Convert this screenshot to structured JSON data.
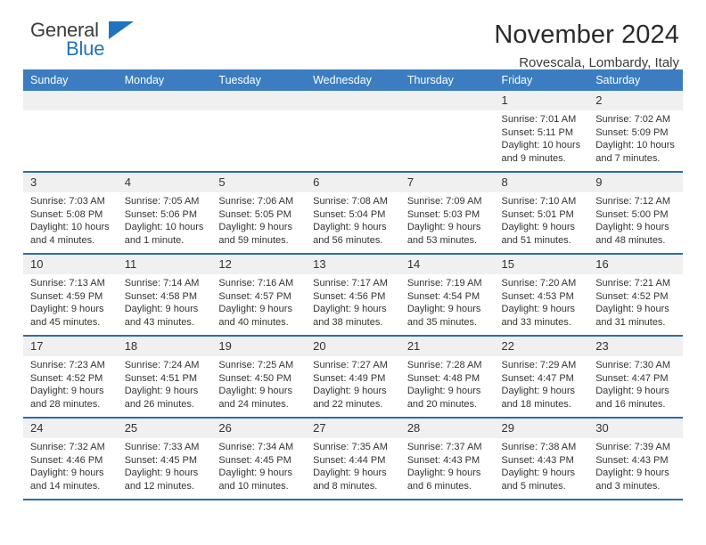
{
  "brand": {
    "name_top": "General",
    "name_bottom": "Blue",
    "triangle_color": "#1f74bd"
  },
  "header": {
    "title": "November 2024",
    "subtitle": "Rovescala, Lombardy, Italy"
  },
  "theme": {
    "header_band": "#3b7dc0",
    "row_rule": "#2a6db4",
    "daynum_band": "#f0f0f0",
    "text": "#333333"
  },
  "weekday_headers": [
    "Sunday",
    "Monday",
    "Tuesday",
    "Wednesday",
    "Thursday",
    "Friday",
    "Saturday"
  ],
  "weeks": [
    [
      {
        "day": "",
        "sunrise": "",
        "sunset": "",
        "daylight": "",
        "empty": true
      },
      {
        "day": "",
        "sunrise": "",
        "sunset": "",
        "daylight": "",
        "empty": true
      },
      {
        "day": "",
        "sunrise": "",
        "sunset": "",
        "daylight": "",
        "empty": true
      },
      {
        "day": "",
        "sunrise": "",
        "sunset": "",
        "daylight": "",
        "empty": true
      },
      {
        "day": "",
        "sunrise": "",
        "sunset": "",
        "daylight": "",
        "empty": true
      },
      {
        "day": "1",
        "sunrise": "Sunrise: 7:01 AM",
        "sunset": "Sunset: 5:11 PM",
        "daylight": "Daylight: 10 hours and 9 minutes.",
        "empty": false
      },
      {
        "day": "2",
        "sunrise": "Sunrise: 7:02 AM",
        "sunset": "Sunset: 5:09 PM",
        "daylight": "Daylight: 10 hours and 7 minutes.",
        "empty": false
      }
    ],
    [
      {
        "day": "3",
        "sunrise": "Sunrise: 7:03 AM",
        "sunset": "Sunset: 5:08 PM",
        "daylight": "Daylight: 10 hours and 4 minutes.",
        "empty": false
      },
      {
        "day": "4",
        "sunrise": "Sunrise: 7:05 AM",
        "sunset": "Sunset: 5:06 PM",
        "daylight": "Daylight: 10 hours and 1 minute.",
        "empty": false
      },
      {
        "day": "5",
        "sunrise": "Sunrise: 7:06 AM",
        "sunset": "Sunset: 5:05 PM",
        "daylight": "Daylight: 9 hours and 59 minutes.",
        "empty": false
      },
      {
        "day": "6",
        "sunrise": "Sunrise: 7:08 AM",
        "sunset": "Sunset: 5:04 PM",
        "daylight": "Daylight: 9 hours and 56 minutes.",
        "empty": false
      },
      {
        "day": "7",
        "sunrise": "Sunrise: 7:09 AM",
        "sunset": "Sunset: 5:03 PM",
        "daylight": "Daylight: 9 hours and 53 minutes.",
        "empty": false
      },
      {
        "day": "8",
        "sunrise": "Sunrise: 7:10 AM",
        "sunset": "Sunset: 5:01 PM",
        "daylight": "Daylight: 9 hours and 51 minutes.",
        "empty": false
      },
      {
        "day": "9",
        "sunrise": "Sunrise: 7:12 AM",
        "sunset": "Sunset: 5:00 PM",
        "daylight": "Daylight: 9 hours and 48 minutes.",
        "empty": false
      }
    ],
    [
      {
        "day": "10",
        "sunrise": "Sunrise: 7:13 AM",
        "sunset": "Sunset: 4:59 PM",
        "daylight": "Daylight: 9 hours and 45 minutes.",
        "empty": false
      },
      {
        "day": "11",
        "sunrise": "Sunrise: 7:14 AM",
        "sunset": "Sunset: 4:58 PM",
        "daylight": "Daylight: 9 hours and 43 minutes.",
        "empty": false
      },
      {
        "day": "12",
        "sunrise": "Sunrise: 7:16 AM",
        "sunset": "Sunset: 4:57 PM",
        "daylight": "Daylight: 9 hours and 40 minutes.",
        "empty": false
      },
      {
        "day": "13",
        "sunrise": "Sunrise: 7:17 AM",
        "sunset": "Sunset: 4:56 PM",
        "daylight": "Daylight: 9 hours and 38 minutes.",
        "empty": false
      },
      {
        "day": "14",
        "sunrise": "Sunrise: 7:19 AM",
        "sunset": "Sunset: 4:54 PM",
        "daylight": "Daylight: 9 hours and 35 minutes.",
        "empty": false
      },
      {
        "day": "15",
        "sunrise": "Sunrise: 7:20 AM",
        "sunset": "Sunset: 4:53 PM",
        "daylight": "Daylight: 9 hours and 33 minutes.",
        "empty": false
      },
      {
        "day": "16",
        "sunrise": "Sunrise: 7:21 AM",
        "sunset": "Sunset: 4:52 PM",
        "daylight": "Daylight: 9 hours and 31 minutes.",
        "empty": false
      }
    ],
    [
      {
        "day": "17",
        "sunrise": "Sunrise: 7:23 AM",
        "sunset": "Sunset: 4:52 PM",
        "daylight": "Daylight: 9 hours and 28 minutes.",
        "empty": false
      },
      {
        "day": "18",
        "sunrise": "Sunrise: 7:24 AM",
        "sunset": "Sunset: 4:51 PM",
        "daylight": "Daylight: 9 hours and 26 minutes.",
        "empty": false
      },
      {
        "day": "19",
        "sunrise": "Sunrise: 7:25 AM",
        "sunset": "Sunset: 4:50 PM",
        "daylight": "Daylight: 9 hours and 24 minutes.",
        "empty": false
      },
      {
        "day": "20",
        "sunrise": "Sunrise: 7:27 AM",
        "sunset": "Sunset: 4:49 PM",
        "daylight": "Daylight: 9 hours and 22 minutes.",
        "empty": false
      },
      {
        "day": "21",
        "sunrise": "Sunrise: 7:28 AM",
        "sunset": "Sunset: 4:48 PM",
        "daylight": "Daylight: 9 hours and 20 minutes.",
        "empty": false
      },
      {
        "day": "22",
        "sunrise": "Sunrise: 7:29 AM",
        "sunset": "Sunset: 4:47 PM",
        "daylight": "Daylight: 9 hours and 18 minutes.",
        "empty": false
      },
      {
        "day": "23",
        "sunrise": "Sunrise: 7:30 AM",
        "sunset": "Sunset: 4:47 PM",
        "daylight": "Daylight: 9 hours and 16 minutes.",
        "empty": false
      }
    ],
    [
      {
        "day": "24",
        "sunrise": "Sunrise: 7:32 AM",
        "sunset": "Sunset: 4:46 PM",
        "daylight": "Daylight: 9 hours and 14 minutes.",
        "empty": false
      },
      {
        "day": "25",
        "sunrise": "Sunrise: 7:33 AM",
        "sunset": "Sunset: 4:45 PM",
        "daylight": "Daylight: 9 hours and 12 minutes.",
        "empty": false
      },
      {
        "day": "26",
        "sunrise": "Sunrise: 7:34 AM",
        "sunset": "Sunset: 4:45 PM",
        "daylight": "Daylight: 9 hours and 10 minutes.",
        "empty": false
      },
      {
        "day": "27",
        "sunrise": "Sunrise: 7:35 AM",
        "sunset": "Sunset: 4:44 PM",
        "daylight": "Daylight: 9 hours and 8 minutes.",
        "empty": false
      },
      {
        "day": "28",
        "sunrise": "Sunrise: 7:37 AM",
        "sunset": "Sunset: 4:43 PM",
        "daylight": "Daylight: 9 hours and 6 minutes.",
        "empty": false
      },
      {
        "day": "29",
        "sunrise": "Sunrise: 7:38 AM",
        "sunset": "Sunset: 4:43 PM",
        "daylight": "Daylight: 9 hours and 5 minutes.",
        "empty": false
      },
      {
        "day": "30",
        "sunrise": "Sunrise: 7:39 AM",
        "sunset": "Sunset: 4:43 PM",
        "daylight": "Daylight: 9 hours and 3 minutes.",
        "empty": false
      }
    ]
  ]
}
